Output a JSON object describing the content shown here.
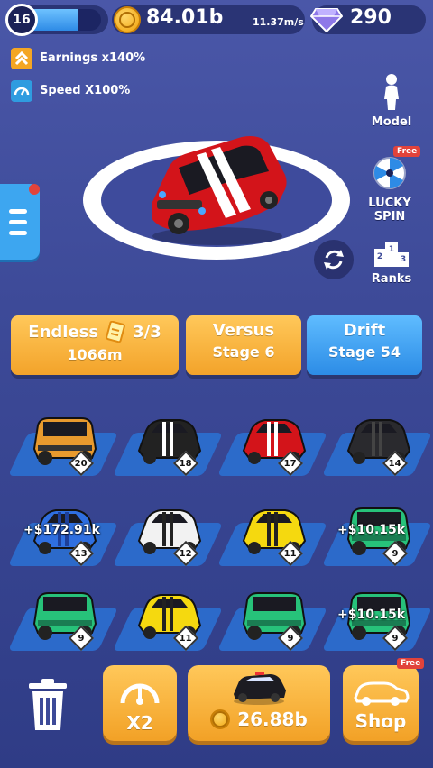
{
  "player": {
    "level": "16",
    "level_progress": 0.7
  },
  "currency": {
    "money": "84.01b",
    "speed": "11.37m/s",
    "gems": "290"
  },
  "boosts": [
    {
      "icon": "chevron-up-icon",
      "label": "Earnings x140%",
      "color": "#f4a623"
    },
    {
      "icon": "speedometer-icon",
      "label": "Speed X100%",
      "color": "#2f9ce0"
    }
  ],
  "side_menu": {
    "model": "Model",
    "lucky_spin": "LUCKY SPIN",
    "lucky_free": "Free",
    "ranks": "Ranks"
  },
  "modes": {
    "endless": {
      "title": "Endless",
      "count": "3/3",
      "distance": "1066m"
    },
    "versus": {
      "title": "Versus",
      "stage": "Stage 6"
    },
    "drift": {
      "title": "Drift",
      "stage": "Stage 54"
    }
  },
  "garage": [
    {
      "car": "jeep-orange",
      "level": "20",
      "earning": ""
    },
    {
      "car": "muscle-black-stripe",
      "level": "18",
      "earning": ""
    },
    {
      "car": "muscle-red-stripe",
      "level": "17",
      "earning": ""
    },
    {
      "car": "police-black",
      "level": "14",
      "earning": ""
    },
    {
      "car": "police-blue",
      "level": "13",
      "earning": "+$172.91k"
    },
    {
      "car": "sport-white",
      "level": "12",
      "earning": ""
    },
    {
      "car": "sport-yellow",
      "level": "11",
      "earning": ""
    },
    {
      "car": "jeep-green",
      "level": "9",
      "earning": "+$10.15k"
    },
    {
      "car": "jeep-green",
      "level": "9",
      "earning": ""
    },
    {
      "car": "sport-yellow",
      "level": "11",
      "earning": ""
    },
    {
      "car": "jeep-green",
      "level": "9",
      "earning": ""
    },
    {
      "car": "jeep-green",
      "level": "9",
      "earning": "+$10.15k"
    }
  ],
  "bottom": {
    "boost_label": "X2",
    "buy_price": "26.88b",
    "shop_label": "Shop",
    "shop_free": "Free"
  },
  "colors": {
    "accent_orange": "#f3a32a",
    "accent_blue": "#2c8ce6",
    "bg": "#3d4a98"
  }
}
